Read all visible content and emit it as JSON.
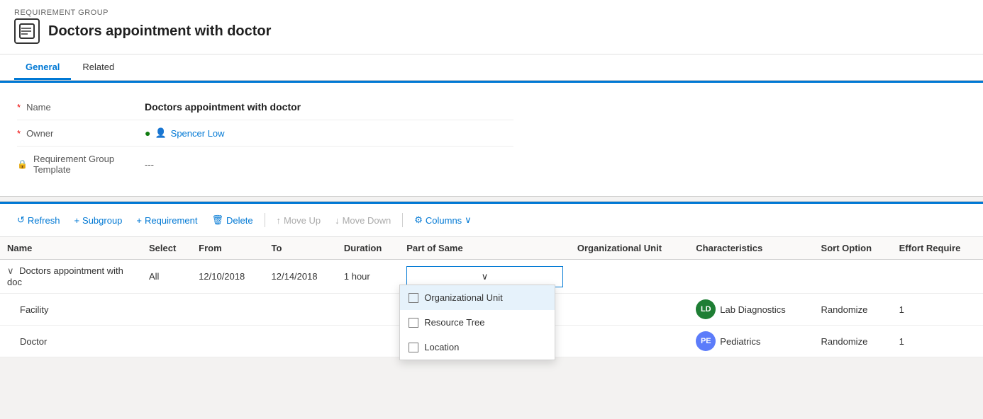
{
  "header": {
    "group_label": "REQUIREMENT GROUP",
    "title": "Doctors appointment with doctor",
    "title_icon": "📋"
  },
  "tabs": [
    {
      "id": "general",
      "label": "General",
      "active": true
    },
    {
      "id": "related",
      "label": "Related",
      "active": false
    }
  ],
  "form": {
    "name_label": "Name",
    "name_value": "Doctors appointment with doctor",
    "owner_label": "Owner",
    "owner_value": "Spencer Low",
    "template_label": "Requirement Group Template",
    "template_value": "---"
  },
  "toolbar": {
    "refresh": "Refresh",
    "subgroup": "Subgroup",
    "requirement": "Requirement",
    "delete": "Delete",
    "move_up": "Move Up",
    "move_down": "Move Down",
    "columns": "Columns"
  },
  "grid": {
    "columns": [
      "Name",
      "Select",
      "From",
      "To",
      "Duration",
      "Part of Same",
      "Organizational Unit",
      "Characteristics",
      "Sort Option",
      "Effort Require"
    ],
    "rows": [
      {
        "name": "Doctors appointment with doc",
        "select": "All",
        "from": "12/10/2018",
        "to": "12/14/2018",
        "duration": "1 hour",
        "part_of_same": "",
        "org_unit_avatar": "",
        "org_unit_initials": "",
        "org_unit_color": "",
        "characteristics": "",
        "sort_option": "",
        "effort": "",
        "expandable": true,
        "indent": 0
      },
      {
        "name": "Facility",
        "select": "",
        "from": "",
        "to": "",
        "duration": "",
        "part_of_same": "",
        "org_unit_avatar": "LD",
        "org_unit_initials": "LD",
        "org_unit_color": "avatar-ld",
        "characteristics": "Lab Diagnostics",
        "sort_option": "Randomize",
        "effort": "1",
        "expandable": false,
        "indent": 1
      },
      {
        "name": "Doctor",
        "select": "",
        "from": "",
        "to": "",
        "duration": "",
        "part_of_same": "",
        "org_unit_avatar": "PE",
        "org_unit_initials": "PE",
        "org_unit_color": "avatar-pe",
        "characteristics": "Pediatrics",
        "sort_option": "Randomize",
        "effort": "1",
        "expandable": false,
        "indent": 1
      }
    ],
    "dropdown_options": [
      {
        "label": "Organizational Unit",
        "checked": false
      },
      {
        "label": "Resource Tree",
        "checked": false
      },
      {
        "label": "Location",
        "checked": false
      }
    ]
  }
}
